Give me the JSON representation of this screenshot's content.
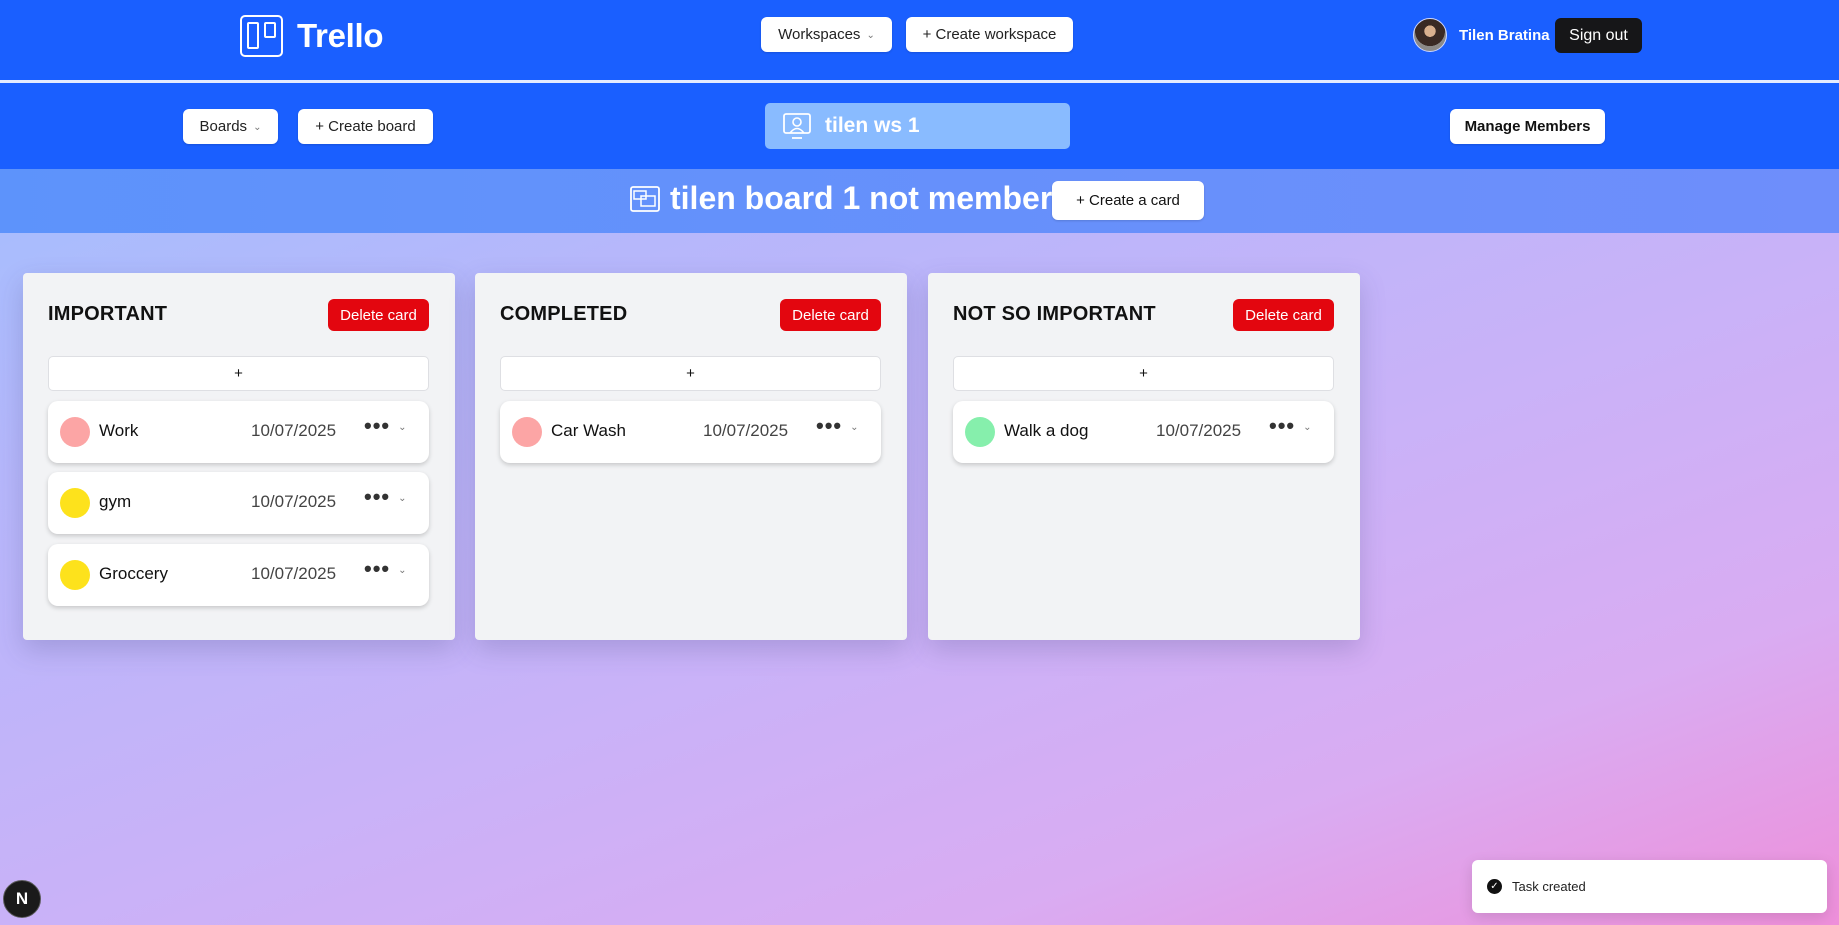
{
  "header": {
    "app_name": "Trello",
    "workspaces_label": "Workspaces",
    "create_workspace_label": "+ Create workspace",
    "user_name": "Tilen Bratina",
    "sign_out_label": "Sign out"
  },
  "subheader": {
    "boards_label": "Boards",
    "create_board_label": "+ Create board",
    "workspace_name": "tilen ws 1",
    "manage_members_label": "Manage Members"
  },
  "board": {
    "title": "tilen board 1 not member",
    "create_card_label": "+ Create a card"
  },
  "columns": [
    {
      "title": "IMPORTANT",
      "delete_label": "Delete card",
      "add_label": "+",
      "tasks": [
        {
          "title": "Work",
          "date": "10/07/2025",
          "color": "#fca5a5"
        },
        {
          "title": "gym",
          "date": "10/07/2025",
          "color": "#fde21c"
        },
        {
          "title": "Groccery",
          "date": "10/07/2025",
          "color": "#fde21c"
        }
      ]
    },
    {
      "title": "COMPLETED",
      "delete_label": "Delete card",
      "add_label": "+",
      "tasks": [
        {
          "title": "Car Wash",
          "date": "10/07/2025",
          "color": "#fca5a5"
        }
      ]
    },
    {
      "title": "NOT SO IMPORTANT",
      "delete_label": "Delete card",
      "add_label": "+",
      "tasks": [
        {
          "title": "Walk a dog",
          "date": "10/07/2025",
          "color": "#86efac"
        }
      ]
    }
  ],
  "card_menu": {
    "dots": "•••",
    "chevron": "⌄"
  },
  "toast": {
    "message": "Task created"
  },
  "dev_badge": {
    "letter": "N"
  },
  "colors": {
    "header_blue": "#1a5fff",
    "delete_red": "#e3060f",
    "workspace_pill": "#89bbff"
  }
}
